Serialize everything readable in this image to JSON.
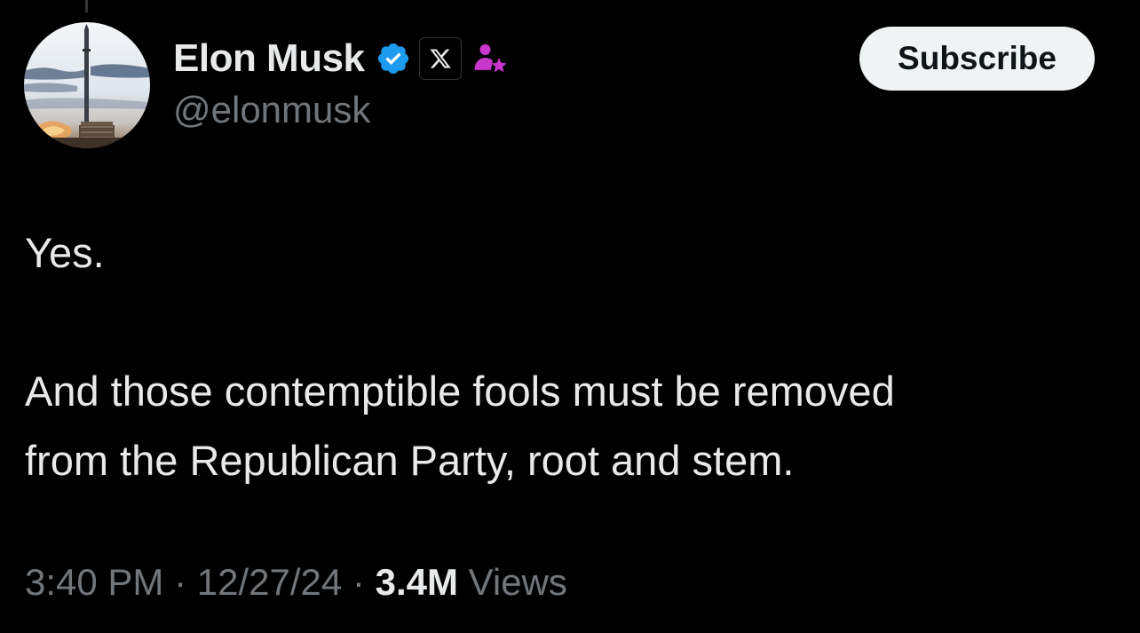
{
  "author": {
    "display_name": "Elon Musk",
    "handle": "@elonmusk",
    "verified": true,
    "affiliate_badge": "x-logo-icon",
    "subscriber_badge": "person-star-icon"
  },
  "subscribe_label": "Subscribe",
  "tweet": {
    "lines": [
      "Yes.",
      "And those contemptible fools must be removed",
      "from the Republican Party, root and stem."
    ]
  },
  "meta": {
    "time": "3:40 PM",
    "separator": "·",
    "date": "12/27/24",
    "view_count": "3.4M",
    "views_label": "Views"
  },
  "colors": {
    "background": "#000000",
    "primary_text": "#e7e9ea",
    "secondary_text": "#71767b",
    "verified_blue": "#1d9bf0",
    "subscriber_purple": "#c936cc",
    "button_bg": "#eff3f4"
  }
}
